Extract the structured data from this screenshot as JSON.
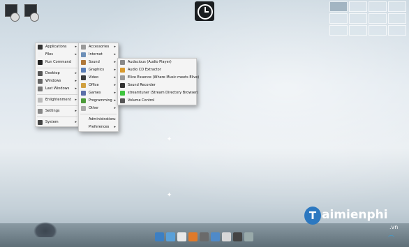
{
  "main_menu": [
    {
      "label": "Applications",
      "arrow": true,
      "icon": "applications-icon",
      "color": "#333"
    },
    {
      "label": "Files",
      "arrow": true,
      "icon": "files-icon",
      "color": "#f2f2f2"
    },
    {
      "label": "Run Command",
      "arrow": false,
      "icon": "run-command-icon",
      "color": "#222"
    },
    {
      "sep": true
    },
    {
      "label": "Desktop",
      "arrow": true,
      "icon": "desktop-icon",
      "color": "#555"
    },
    {
      "label": "Windows",
      "arrow": true,
      "icon": "windows-icon",
      "color": "#666"
    },
    {
      "label": "Last Windows",
      "arrow": true,
      "icon": "last-windows-icon",
      "color": "#777"
    },
    {
      "sep": true
    },
    {
      "label": "Enlightenment",
      "arrow": true,
      "icon": "enlightenment-icon",
      "color": "#bbb"
    },
    {
      "sep": true
    },
    {
      "label": "Settings",
      "arrow": true,
      "icon": "settings-icon",
      "color": "#888"
    },
    {
      "sep": true
    },
    {
      "label": "System",
      "arrow": true,
      "icon": "system-icon",
      "color": "#444"
    }
  ],
  "apps_menu": [
    {
      "label": "Accessories",
      "arrow": true,
      "icon": "accessories-icon",
      "color": "#9a9a9a"
    },
    {
      "label": "Internet",
      "arrow": true,
      "icon": "internet-icon",
      "color": "#6c8fb8"
    },
    {
      "label": "Sound",
      "arrow": true,
      "icon": "sound-icon",
      "color": "#b0783a"
    },
    {
      "label": "Graphics",
      "arrow": true,
      "icon": "graphics-icon",
      "color": "#5a7db5"
    },
    {
      "label": "Video",
      "arrow": true,
      "icon": "video-icon",
      "color": "#3a3a3a"
    },
    {
      "label": "Office",
      "arrow": true,
      "icon": "office-icon",
      "color": "#d0a040"
    },
    {
      "label": "Games",
      "arrow": true,
      "icon": "games-icon",
      "color": "#5b6fa8"
    },
    {
      "label": "Programming",
      "arrow": true,
      "icon": "programming-icon",
      "color": "#4c9a3a"
    },
    {
      "label": "Other",
      "arrow": true,
      "icon": "other-icon",
      "color": "#aaa"
    },
    {
      "sep": true
    },
    {
      "label": "Administration",
      "arrow": true,
      "icon": "administration-icon",
      "color": "#f4f4f4"
    },
    {
      "label": "Preferences",
      "arrow": true,
      "icon": "preferences-icon",
      "color": "#f4f4f4"
    }
  ],
  "sound_menu": [
    {
      "label": "Audacious (Audio Player)",
      "icon": "audacious-icon",
      "color": "#888"
    },
    {
      "label": "Audio CD Extractor",
      "icon": "cd-extractor-icon",
      "color": "#d89a30"
    },
    {
      "label": "Elive Essence (Where Music meets Elive)",
      "icon": "elive-essence-icon",
      "color": "#999"
    },
    {
      "label": "Sound Recorder",
      "icon": "sound-recorder-icon",
      "color": "#333"
    },
    {
      "label": "streamtuner (Stream Directory Browser)",
      "icon": "streamtuner-icon",
      "color": "#3ec43e"
    },
    {
      "label": "Volume Control",
      "icon": "volume-control-icon",
      "color": "#555"
    }
  ],
  "watermark": {
    "brand": "aimienphi",
    "brand_initial": "T",
    "tld": ".vn"
  },
  "taskbar_icons": [
    "monitor-icon",
    "search-icon",
    "document-icon",
    "firefox-icon",
    "media-player-icon",
    "settings-icon",
    "files-icon",
    "terminal-icon",
    "trash-icon"
  ]
}
